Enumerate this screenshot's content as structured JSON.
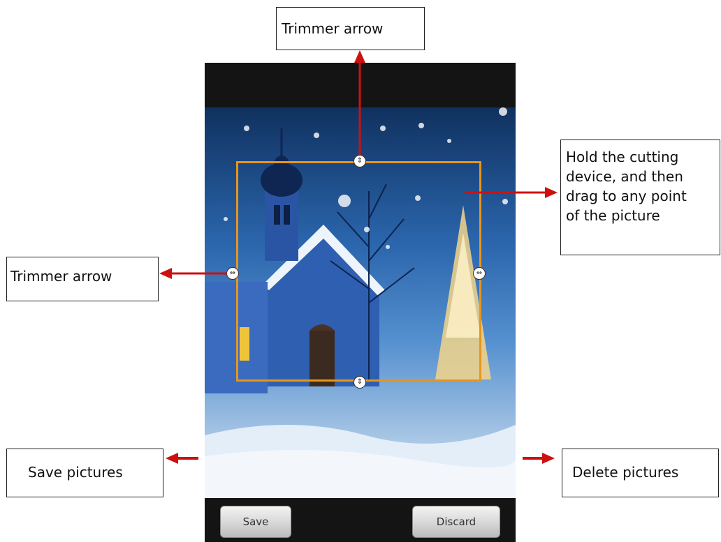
{
  "callouts": {
    "top_trimmer": "Trimmer arrow",
    "left_trimmer": "Trimmer arrow",
    "hold_line1": "Hold the cutting",
    "hold_line2": "device, and then",
    "hold_line3": "drag to any point",
    "hold_line4": "of the picture",
    "save_pictures": "Save pictures",
    "delete_pictures": "Delete pictures"
  },
  "buttons": {
    "save": "Save",
    "discard": "Discard"
  },
  "icons": {
    "vertical_handle": "vertical-resize-icon",
    "horizontal_handle": "horizontal-resize-icon"
  },
  "colors": {
    "crop_border": "#e8951c",
    "arrow": "#cc1111"
  }
}
